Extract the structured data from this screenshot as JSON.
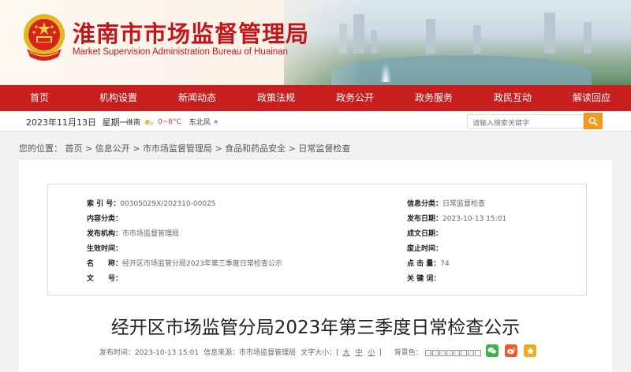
{
  "header": {
    "title": "淮南市市场监督管理局",
    "subtitle": "Market Supervision Administration Bureau of Huainan"
  },
  "nav": {
    "items": [
      "首页",
      "机构设置",
      "新闻动态",
      "政策法规",
      "政务公开",
      "政务服务",
      "政民互动",
      "解读回应"
    ]
  },
  "infobar": {
    "date": "2023年11月13日",
    "weekday": "星期一",
    "city": "淮南",
    "temp": "0~8°C",
    "wind": "东北风",
    "more": "»",
    "search_placeholder": "请输入搜索关键字"
  },
  "breadcrumb": {
    "prefix": "您的位置：",
    "items": [
      "首页",
      "信息公开",
      "市市场监督管理局",
      "食品和药品安全",
      "日常监督检查"
    ],
    "sep": " > "
  },
  "meta": {
    "left": [
      {
        "k": "索 引 号：",
        "v": "00305029X/202310-00025"
      },
      {
        "k": "内容分类：",
        "v": ""
      },
      {
        "k": "发布机构：",
        "v": "市市场监督管理局"
      },
      {
        "k": "生效时间：",
        "v": ""
      },
      {
        "k": "名　　称：",
        "v": "经开区市场监管分局2023年第三季度日常检查公示"
      },
      {
        "k": "文　　号：",
        "v": ""
      }
    ],
    "right": [
      {
        "k": "信息分类：",
        "v": "日常监督检查"
      },
      {
        "k": "发布日期：",
        "v": "2023-10-13 15:01"
      },
      {
        "k": "成文日期：",
        "v": ""
      },
      {
        "k": "废止时间：",
        "v": ""
      },
      {
        "k": "点 击 量：",
        "v": "74"
      },
      {
        "k": "关 键 词：",
        "v": ""
      }
    ]
  },
  "article": {
    "title": "经开区市场监管分局2023年第三季度日常检查公示",
    "publish_label": "发布时间：",
    "publish_time": "2023-10-13 15:01",
    "source_label": "信息来源：",
    "source": "市市场监督管理局",
    "font_label": "文字大小：[",
    "font_large": "大",
    "font_medium": "中",
    "font_small": "小",
    "font_close": "]",
    "bg_label": "背景色："
  },
  "colors": {
    "brand_red": "#c81e1e",
    "search_orange": "#f29a1f",
    "wechat_green": "#3bb34a",
    "weibo_orange": "#f05a28",
    "fav_orange": "#f5a623"
  },
  "icons": [
    "national-emblem-icon",
    "search-icon",
    "weather-sun-icon",
    "wechat-icon",
    "weibo-icon",
    "favorite-icon"
  ]
}
